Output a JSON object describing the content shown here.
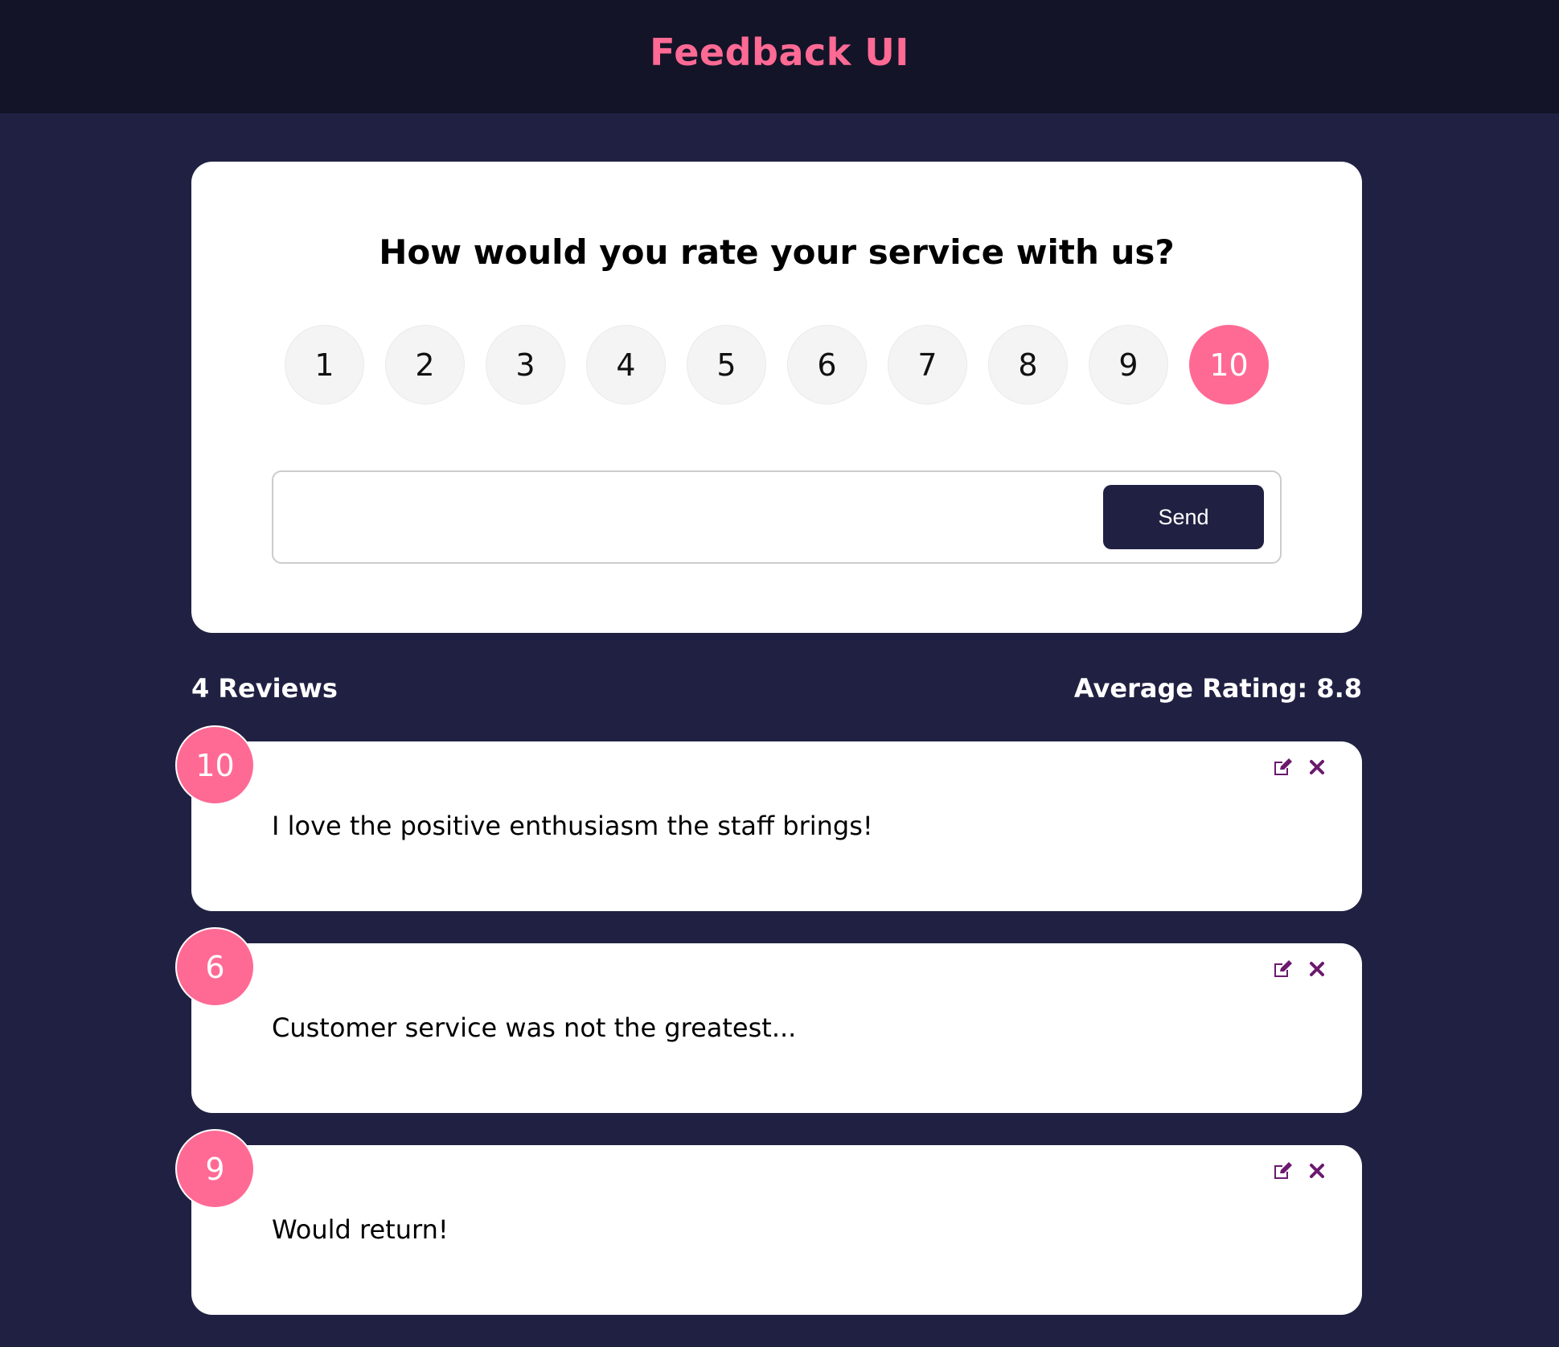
{
  "header": {
    "title": "Feedback UI"
  },
  "rating_form": {
    "question": "How would you rate your service with us?",
    "options": [
      "1",
      "2",
      "3",
      "4",
      "5",
      "6",
      "7",
      "8",
      "9",
      "10"
    ],
    "selected": "10",
    "input_value": "",
    "send_label": "Send"
  },
  "stats": {
    "reviews_label": "4 Reviews",
    "average_label": "Average Rating: 8.8"
  },
  "reviews": [
    {
      "rating": "10",
      "text": "I love the positive enthusiasm the staff brings!"
    },
    {
      "rating": "6",
      "text": "Customer service was not the greatest..."
    },
    {
      "rating": "9",
      "text": "Would return!"
    }
  ],
  "colors": {
    "accent": "#ff6a95",
    "background": "#202142",
    "header": "#141428",
    "icon": "#6b1a6e"
  },
  "icons": {
    "edit": "edit-icon",
    "close": "close-icon"
  }
}
